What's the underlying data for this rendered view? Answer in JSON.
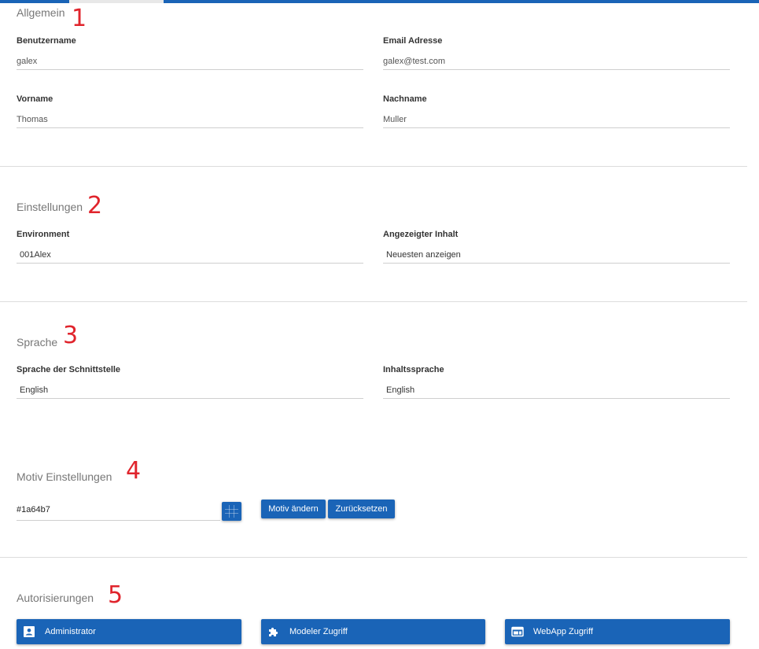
{
  "theme": {
    "accent": "#1a64b7",
    "annotation": "#e0242c"
  },
  "allgemein": {
    "title": "Allgemein",
    "marker": "1",
    "benutzername_label": "Benutzername",
    "benutzername_value": "galex",
    "email_label": "Email Adresse",
    "email_value": "galex@test.com",
    "vorname_label": "Vorname",
    "vorname_value": "Thomas",
    "nachname_label": "Nachname",
    "nachname_value": "Muller"
  },
  "einstellungen": {
    "title": "Einstellungen",
    "marker": "2",
    "environment_label": "Environment",
    "environment_value": "001Alex",
    "inhalt_label": "Angezeigter Inhalt",
    "inhalt_value": "Neuesten anzeigen"
  },
  "sprache": {
    "title": "Sprache",
    "marker": "3",
    "schnittstelle_label": "Sprache der Schnittstelle",
    "schnittstelle_value": "English",
    "inhaltssprache_label": "Inhaltssprache",
    "inhaltssprache_value": "English"
  },
  "motiv": {
    "title": "Motiv Einstellungen",
    "marker": "4",
    "color_value": "#1a64b7",
    "picker_icon": "color-grid-icon",
    "change_label": "Motiv ändern",
    "reset_label": "Zurücksetzen"
  },
  "autorisierungen": {
    "title": "Autorisierungen",
    "marker": "5",
    "admin_label": "Administrator",
    "admin_icon": "account-box-icon",
    "modeler_label": "Modeler Zugriff",
    "modeler_icon": "puzzle-icon",
    "webapp_label": "WebApp Zugriff",
    "webapp_icon": "web-window-icon"
  }
}
